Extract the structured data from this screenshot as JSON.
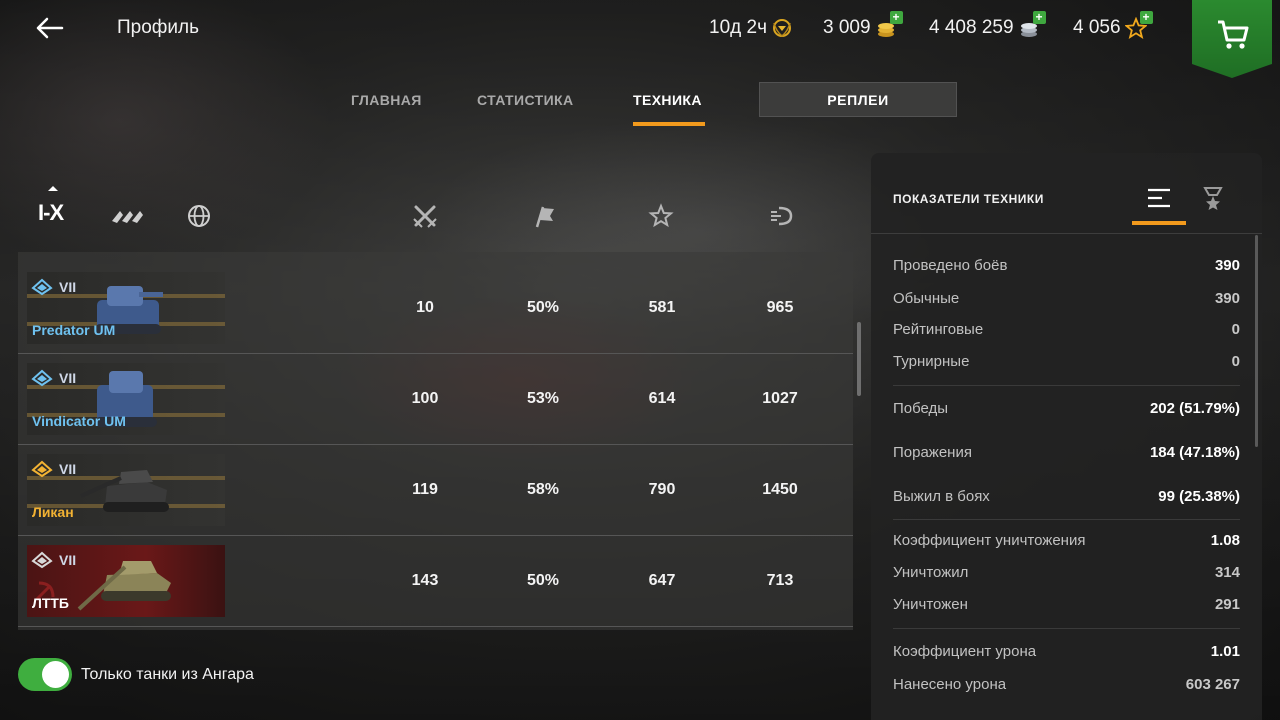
{
  "header": {
    "title": "Профиль",
    "premium_time": "10д 2ч",
    "gold": "3 009",
    "credits": "4 408 259",
    "free_xp": "4 056",
    "plus_symbol": "+"
  },
  "tabs": {
    "main": "ГЛАВНАЯ",
    "stats": "СТАТИСТИКА",
    "vehicles": "ТЕХНИКА",
    "replays": "РЕПЛЕИ",
    "active": "ТЕХНИКА"
  },
  "filters": {
    "tier_range": "I-X"
  },
  "table": {
    "columns": [
      "battles-icon",
      "win-rate-icon",
      "avg-xp-icon",
      "avg-damage-icon"
    ],
    "rows": [
      {
        "tier": "VII",
        "name": "Predator UM",
        "name_color": "#6fc2f0",
        "battles": "10",
        "winrate": "50%",
        "avg_xp": "581",
        "avg_damage": "965"
      },
      {
        "tier": "VII",
        "name": "Vindicator UM",
        "name_color": "#6fc2f0",
        "battles": "100",
        "winrate": "53%",
        "avg_xp": "614",
        "avg_damage": "1027"
      },
      {
        "tier": "VII",
        "name": "Ликан",
        "name_color": "#f2b233",
        "battles": "119",
        "winrate": "58%",
        "avg_xp": "790",
        "avg_damage": "1450"
      },
      {
        "tier": "VII",
        "name": "ЛТТБ",
        "name_color": "#ffffff",
        "battles": "143",
        "winrate": "50%",
        "avg_xp": "647",
        "avg_damage": "713"
      }
    ]
  },
  "toggle": {
    "label": "Только танки из Ангара",
    "on": true
  },
  "panel": {
    "title": "ПОКАЗАТЕЛИ ТЕХНИКИ",
    "stats": [
      {
        "label": "Проведено боёв",
        "value": "390"
      },
      {
        "label": "Обычные",
        "value": "390"
      },
      {
        "label": "Рейтинговые",
        "value": "0"
      },
      {
        "label": "Турнирные",
        "value": "0"
      },
      {
        "label": "Победы",
        "value": "202 (51.79%)"
      },
      {
        "label": "Поражения",
        "value": "184 (47.18%)"
      },
      {
        "label": "Выжил в боях",
        "value": "99 (25.38%)"
      },
      {
        "label": "Коэффициент уничтожения",
        "value": "1.08"
      },
      {
        "label": "Уничтожил",
        "value": "314"
      },
      {
        "label": "Уничтожен",
        "value": "291"
      },
      {
        "label": "Коэффициент урона",
        "value": "1.01"
      },
      {
        "label": "Нанесено урона",
        "value": "603 267"
      }
    ]
  },
  "colors": {
    "accent": "#f29a1d",
    "toggle_on": "#3fae3f",
    "shop_green": "#2b8a2f"
  }
}
